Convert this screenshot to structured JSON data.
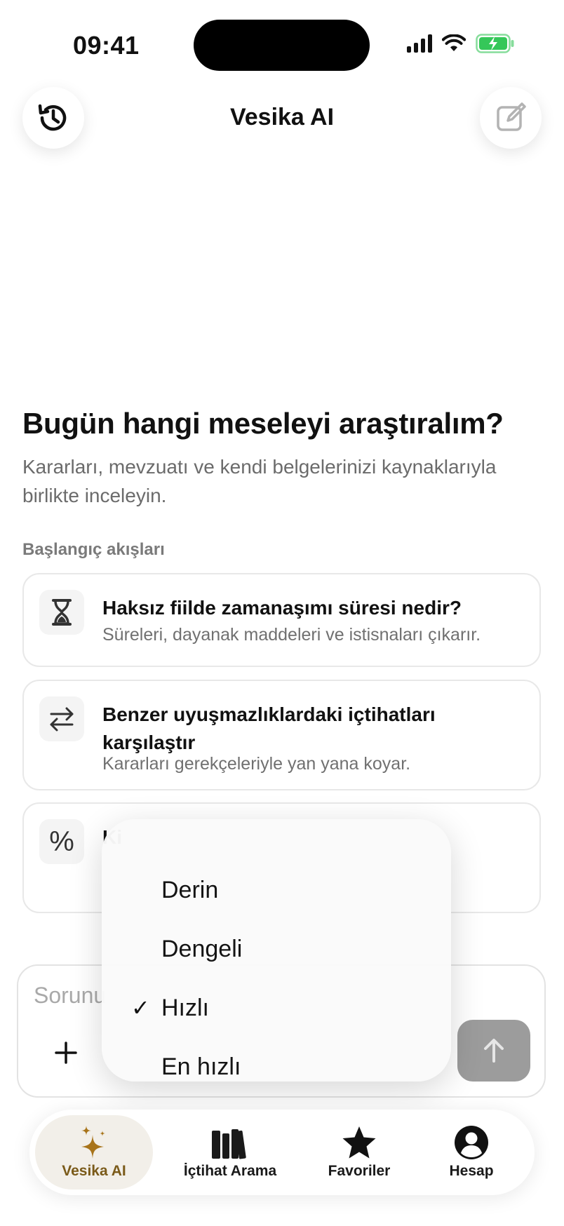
{
  "status_bar": {
    "time": "09:41"
  },
  "header": {
    "title": "Vesika AI",
    "history_icon": "history-clock-icon",
    "new_chat_icon": "compose-icon"
  },
  "hero": {
    "title": "Bugün hangi meseleyi araştıralım?",
    "subtitle": "Kararları, mevzuatı ve kendi belgelerinizi kaynaklarıyla birlikte inceleyin."
  },
  "starters": {
    "label": "Başlangıç akışları",
    "items": [
      {
        "icon": "hourglass-icon",
        "title": "Haksız fiilde zamanaşımı süresi nedir?",
        "subtitle": "Süreleri, dayanak maddeleri ve istisnaları çıkarır."
      },
      {
        "icon": "compare-arrows-icon",
        "title": "Benzer uyuşmazlıklardaki içtihatları karşılaştır",
        "subtitle": "Kararları gerekçeleriyle yan yana koyar."
      },
      {
        "icon": "percent-icon",
        "title": "Ki",
        "subtitle": ""
      }
    ]
  },
  "composer": {
    "placeholder": "Sorunu"
  },
  "mode_menu": {
    "items": [
      {
        "label": "Derin",
        "selected": false
      },
      {
        "label": "Dengeli",
        "selected": false
      },
      {
        "label": "Hızlı",
        "selected": true
      },
      {
        "label": "En hızlı",
        "selected": false
      }
    ],
    "check_glyph": "✓"
  },
  "tabs": [
    {
      "label": "Vesika AI",
      "icon": "sparkles-icon",
      "active": true
    },
    {
      "label": "İçtihat Arama",
      "icon": "books-icon",
      "active": false
    },
    {
      "label": "Favoriler",
      "icon": "star-icon",
      "active": false
    },
    {
      "label": "Hesap",
      "icon": "person-icon",
      "active": false
    }
  ],
  "colors": {
    "accent": "#A8741A",
    "active_tab_bg": "#F2EFE9",
    "send_button": "#9C9C9C",
    "battery_green": "#35C759"
  }
}
